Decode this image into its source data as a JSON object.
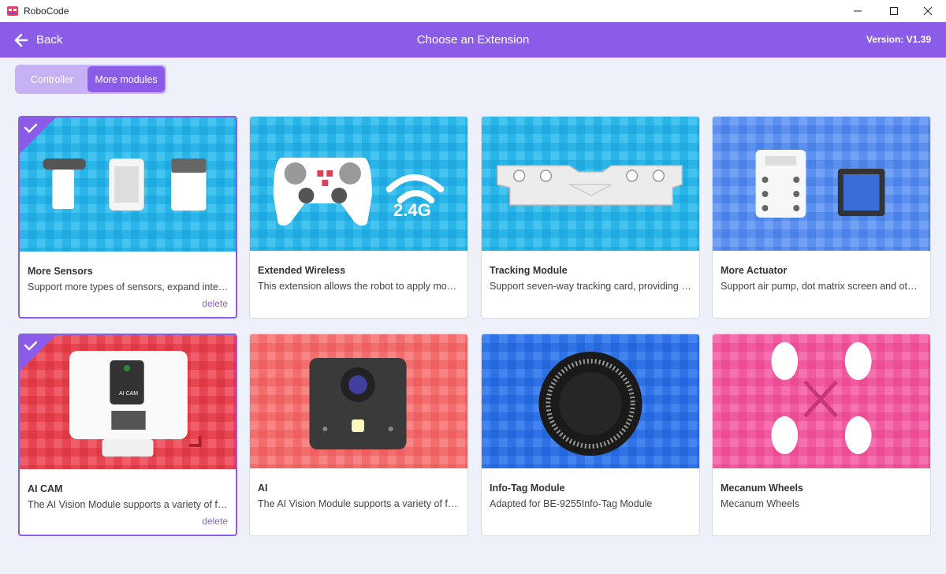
{
  "window": {
    "title": "RoboCode"
  },
  "header": {
    "back_label": "Back",
    "title": "Choose an Extension",
    "version": "Version:  V1.39"
  },
  "tabs": [
    {
      "label": "Controller",
      "active": false
    },
    {
      "label": "More modules",
      "active": true
    }
  ],
  "cards": [
    {
      "name": "More Sensors",
      "desc": "Support more types of sensors, expand interface",
      "selected": true,
      "delete_label": "delete",
      "theme": "blue"
    },
    {
      "name": "Extended Wireless",
      "desc": "This extension allows the robot to apply more wireless",
      "selected": false,
      "theme": "blue",
      "badge": "2.4G"
    },
    {
      "name": "Tracking Module",
      "desc": "Support seven-way tracking card, providing more",
      "selected": false,
      "theme": "blue"
    },
    {
      "name": "More Actuator",
      "desc": "Support air pump, dot matrix screen and other actuators",
      "selected": false,
      "theme": "lightblue"
    },
    {
      "name": "AI CAM",
      "desc": "The AI Vision Module supports a variety of functions",
      "selected": true,
      "delete_label": "delete",
      "theme": "red",
      "device_label": "AI CAM"
    },
    {
      "name": "AI",
      "desc": "The AI Vision Module supports a variety of functions",
      "selected": false,
      "theme": "salmon"
    },
    {
      "name": "Info-Tag Module",
      "desc": "Adapted for BE-9255Info-Tag Module",
      "selected": false,
      "theme": "royal"
    },
    {
      "name": "Mecanum Wheels",
      "desc": "Mecanum Wheels",
      "selected": false,
      "theme": "pink"
    }
  ],
  "colors": {
    "accent": "#8a5ce8",
    "tab_track": "#c7b1f5",
    "page_bg": "#eef1fa"
  }
}
